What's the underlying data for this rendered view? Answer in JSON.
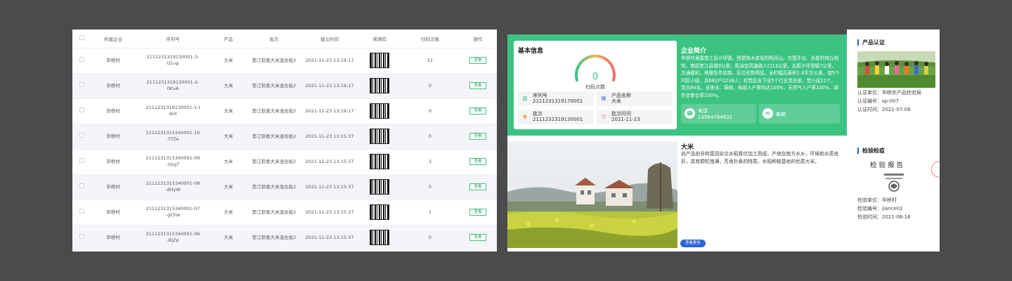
{
  "table": {
    "headers": [
      "所属企业",
      "序列号",
      "产品",
      "批次",
      "建立时间",
      "溯源码",
      "扫码次数",
      "操作"
    ],
    "view_label": "查看",
    "rows": [
      {
        "company": "毕桥村",
        "serial_1": "2111231319130001-3-",
        "serial_2": "O1vp",
        "product": "大米",
        "batch": "垫江软香大米混合批2",
        "created": "2021-11-23 13:19:17",
        "scans": "21"
      },
      {
        "company": "毕桥村",
        "serial_1": "2111231319130001-2-",
        "serial_2": "0KvA",
        "product": "大米",
        "batch": "垫江软香大米混合批2",
        "created": "2021-11-23 13:19:17",
        "scans": "0"
      },
      {
        "company": "毕桥村",
        "serial_1": "2111231319130001-1-I",
        "serial_2": "4r0",
        "product": "大米",
        "batch": "垫江软香大米混合批2",
        "created": "2021-11-23 13:19:17",
        "scans": "0"
      },
      {
        "company": "毕桥村",
        "serial_1": "2111231315340001-10",
        "serial_2": "-f7Ze",
        "product": "大米",
        "batch": "垫江软香大米混合批2",
        "created": "2021-11-23 13:15:37",
        "scans": "0"
      },
      {
        "company": "毕桥村",
        "serial_1": "2111231315340001-09",
        "serial_2": "-UsgT",
        "product": "大米",
        "batch": "垫江软香大米混合批2",
        "created": "2021-11-23 13:15:37",
        "scans": "3"
      },
      {
        "company": "毕桥村",
        "serial_1": "2111231315340001-08",
        "serial_2": "-dHyW",
        "product": "大米",
        "batch": "垫江软香大米混合批2",
        "created": "2021-11-23 13:15:37",
        "scans": "5"
      },
      {
        "company": "毕桥村",
        "serial_1": "2111231315340001-07",
        "serial_2": "-gChw",
        "product": "大米",
        "batch": "垫江软香大米混合批2",
        "created": "2021-11-23 13:15:37",
        "scans": "1"
      },
      {
        "company": "毕桥村",
        "serial_1": "2111231315340001-06",
        "serial_2": "-BjZp",
        "product": "大米",
        "batch": "垫江软香大米混合批2",
        "created": "2021-11-23 13:15:37",
        "scans": "0"
      }
    ]
  },
  "basic": {
    "title": "基本信息",
    "scan_count": "0",
    "scan_label": "扫码次数",
    "serial_label": "序列号",
    "serial_value": "2111231319170001",
    "product_label": "产品名称",
    "product_value": "大米",
    "batch_label": "批次",
    "batch_value": "2111231319130001",
    "time_label": "批次时间",
    "time_value": "2021-11-23"
  },
  "company": {
    "title": "企业简介",
    "text": "毕桥村隶属垫江县沙坪镇，西望抹木茶垭的明月山，东靠手台、永胜村戏丘地带，南距垫江县城9公里，距渝宜高速路入口13公里，北距沙坪场镇7公里，交通便利，地理条件优越，区位优势明显。全村幅员面积1.8平方公里，辖5个村民小组，共682户2238人；村党总支下设5个行业党支部，党小组12个，党员84名。自来水、网络、电视入户率均达100%，天然气入户率100%，新农合参合率100%。",
    "phone_label": "电话",
    "phone_value": "13984784631",
    "email_label": "邮箱"
  },
  "product": {
    "name": "大米",
    "desc": "此产品由非转基因杂交水稻春优加工而成。产地在南方水乡，环境和水质良好，具有颗粒饱满，芳香扑鼻的特质。水稻种植基地的优质大米。",
    "more_label": "查看更多"
  },
  "certification": {
    "title": "产品认证",
    "unit": "认证单位：毕桥农产品检验局",
    "number": "认证编号：sp-007",
    "time": "认证时间：2021-07-06"
  },
  "inspection": {
    "title": "检验检疫",
    "report_title": "检验报告",
    "unit": "检验单位：毕桥村",
    "number": "检验编号：jiance01",
    "time": "检验时间：2021-06-16"
  },
  "colors": {
    "accent_green": "#3cc382",
    "accent_blue": "#2d64d6",
    "backdrop": "#4b4b4b"
  }
}
